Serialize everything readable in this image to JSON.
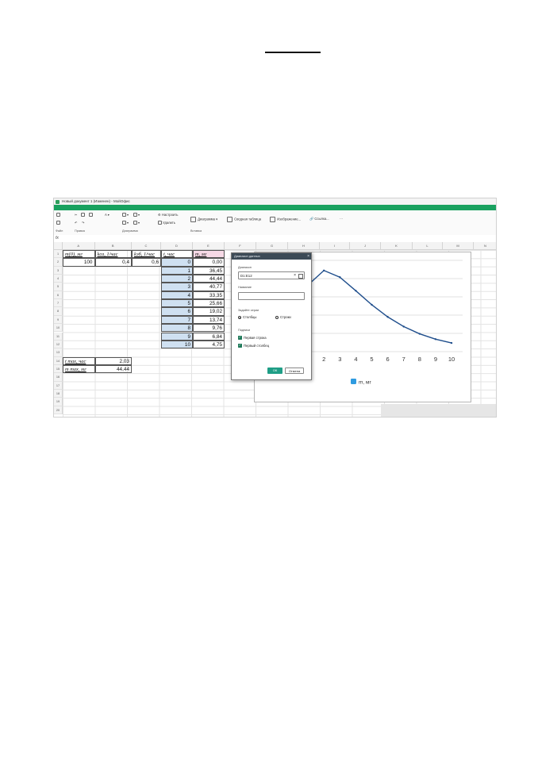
{
  "window": {
    "title": "Новый документ 1 (Изменен) - МойОфис"
  },
  "menu": [
    "Файл",
    "Правка",
    "Вставка",
    "Формат",
    "Таблица",
    "Данные",
    "Инструменты",
    "Вид",
    "Объединения",
    "Надстройки",
    "Справка"
  ],
  "ribbon": {
    "groups": [
      "Файл",
      "Правка",
      "Диаграмма",
      "Вставка"
    ],
    "customize_label": "Настроить",
    "delete_label": "Удалить",
    "diagram_label": "Диаграмма",
    "pivot_label": "Сводная таблица",
    "image_label": "Изображение...",
    "link_label": "Ссылка...",
    "more_label": "···"
  },
  "formula_bar": {
    "fx": "fx"
  },
  "columns": [
    "A",
    "B",
    "C",
    "D",
    "E",
    "F",
    "G",
    "H",
    "I",
    "J",
    "K",
    "L",
    "M",
    "N"
  ],
  "rows": [
    "1",
    "2",
    "3",
    "4",
    "5",
    "6",
    "7",
    "8",
    "9",
    "10",
    "11",
    "12",
    "13",
    "14",
    "15",
    "16",
    "17",
    "18",
    "19",
    "20"
  ],
  "sheet": {
    "a1": "m(0), мг",
    "b1": "kса, 1/час",
    "c1": "kэб, 1/час",
    "d1": "t, час",
    "e1": "m, мг",
    "a2": "100",
    "b2": "0,4",
    "c2": "0,6",
    "t_values": [
      "0",
      "1",
      "2",
      "3",
      "4",
      "5",
      "6",
      "7",
      "8",
      "9",
      "10"
    ],
    "m_values": [
      "0,00",
      "36,45",
      "44,44",
      "40,77",
      "33,35",
      "25,66",
      "19,02",
      "13,74",
      "9,76",
      "6,84",
      "4,75"
    ],
    "a14": "t max, час",
    "b14": "2,03",
    "a15": "m max, мг",
    "b15": "44,44"
  },
  "dialog": {
    "title": "Диапазон данных",
    "range_label": "Диапазон",
    "range_value": "D1:E12",
    "name_label": "Название",
    "name_value": "",
    "series_label": "Задайте серии",
    "option_columns": "Столбцы",
    "option_rows": "Строки",
    "captions_label": "Подписи",
    "check_first_row": "Первая строка",
    "check_first_col": "Первый столбец",
    "ok_label": "ОК",
    "cancel_label": "Отмена"
  },
  "chart_data": {
    "type": "line",
    "x": [
      0,
      1,
      2,
      3,
      4,
      5,
      6,
      7,
      8,
      9,
      10
    ],
    "series": [
      {
        "name": "m, мг",
        "values": [
          0.0,
          36.45,
          44.44,
          40.77,
          33.35,
          25.66,
          19.02,
          13.74,
          9.76,
          6.84,
          4.75
        ]
      }
    ],
    "visible_x_ticks": [
      "2",
      "3",
      "4",
      "5",
      "6",
      "7",
      "8",
      "9",
      "10"
    ],
    "ylim": [
      0,
      50
    ],
    "grid": true,
    "legend": "bottom",
    "color": "#1f4e8c"
  }
}
